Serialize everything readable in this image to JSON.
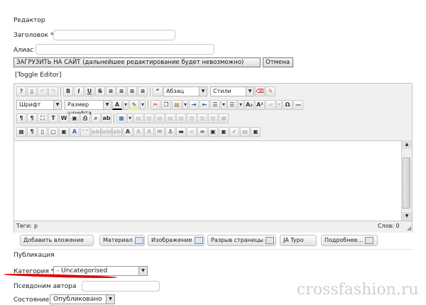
{
  "editor_heading": "Редактор",
  "form": {
    "title_label": "Заголовок *",
    "alias_label": "Алиас",
    "publish_button": "ЗАГРУЗИТЬ НА САЙТ (дальнейшее редактирование будет невозможно)",
    "cancel_button": "Отмена",
    "toggle_editor": "[Toggle Editor]"
  },
  "toolbar": {
    "format_select": "Абзац",
    "styles_select": "Стили",
    "font_select": "Шрифт",
    "size_select": "Размер шрифта"
  },
  "status": {
    "path_label": "Теги:",
    "path_value": "p",
    "words_label": "Слов: 0"
  },
  "editor_buttons": [
    "Добавить вложение",
    "Материал",
    "Изображение",
    "Разрыв страницы",
    "JA Typo",
    "Подробнее..."
  ],
  "publication": {
    "heading": "Публикация",
    "category_label": "Категория *",
    "category_value": "- Uncategorised",
    "author_alias_label": "Псевдоним автора",
    "state_label": "Состояние",
    "state_value": "Опубликовано"
  },
  "watermark": "crossfashion.ru",
  "colors": {
    "annotation_underline": "#e00000",
    "watermark": "#cfcfcf"
  }
}
